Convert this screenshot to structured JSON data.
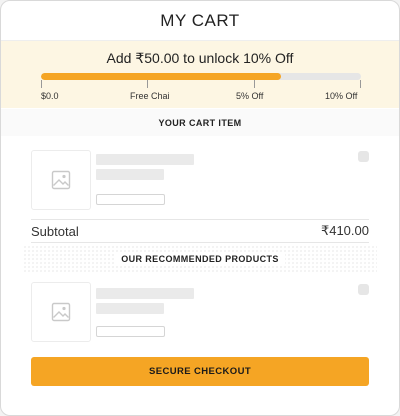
{
  "header": {
    "title": "MY CART"
  },
  "offer": {
    "message": "Add ₹50.00 to unlock 10% Off",
    "progress_percent": 75,
    "milestones": [
      "$0.0",
      "Free Chai",
      "5% Off",
      "10% Off"
    ]
  },
  "cart_section": {
    "title": "YOUR CART ITEM"
  },
  "subtotal": {
    "label": "Subtotal",
    "amount": "₹410.00"
  },
  "recommended_section": {
    "title": "OUR RECOMMENDED PRODUCTS"
  },
  "checkout": {
    "label": "SECURE CHECKOUT"
  },
  "colors": {
    "accent": "#f5a524",
    "offer_bg": "#fdf6e3",
    "track": "#e6e6e6"
  },
  "icons": {
    "product_placeholder": "image-placeholder-icon"
  }
}
